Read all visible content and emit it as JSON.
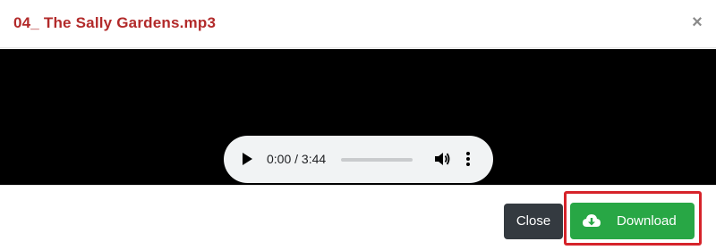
{
  "dialog": {
    "title": "04_ The Sally Gardens.mp3",
    "close_symbol": "×",
    "title_color": "#b22a2a"
  },
  "player": {
    "current_time": "0:00",
    "duration": "3:44",
    "time_text": "0:00 / 3:44",
    "progress_fraction": 0,
    "icons": {
      "play": "play-icon",
      "volume": "volume-icon",
      "menu": "more-vertical-icon"
    }
  },
  "footer": {
    "close_label": "Close",
    "download_label": "Download",
    "download_icon": "cloud-download-icon",
    "colors": {
      "close_bg": "#343a40",
      "download_bg": "#28a745",
      "highlight_border": "#d6232a"
    }
  }
}
